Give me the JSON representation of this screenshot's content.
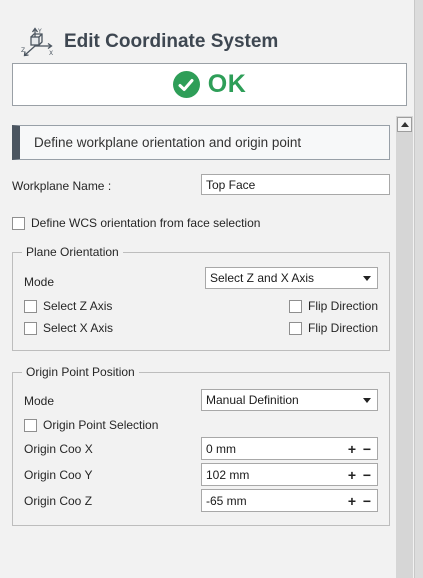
{
  "header": {
    "title": "Edit Coordinate System",
    "icon": "coordinate-system-icon",
    "axis_labels": [
      "Y",
      "Z",
      "X"
    ]
  },
  "ok_button": {
    "label": "OK",
    "icon": "check-circle-icon",
    "color": "#2e9e58"
  },
  "section_banner": {
    "text": "Define workplane orientation and origin point"
  },
  "workplane": {
    "label": "Workplane Name :",
    "value": "Top Face"
  },
  "wcs_checkbox": {
    "label": "Define WCS orientation from face selection",
    "checked": false
  },
  "plane_orientation": {
    "title": "Plane Orientation",
    "mode_label": "Mode",
    "mode_value": "Select Z and X Axis",
    "select_z": {
      "label": "Select Z Axis",
      "checked": false
    },
    "select_x": {
      "label": "Select X Axis",
      "checked": false
    },
    "flip_z": {
      "label": "Flip Direction",
      "checked": false
    },
    "flip_x": {
      "label": "Flip Direction",
      "checked": false
    }
  },
  "origin_point": {
    "title": "Origin Point Position",
    "mode_label": "Mode",
    "mode_value": "Manual Definition",
    "selection": {
      "label": "Origin Point Selection",
      "checked": false
    },
    "coo_x": {
      "label": "Origin Coo X",
      "value": "0 mm"
    },
    "coo_y": {
      "label": "Origin Coo Y",
      "value": "102 mm"
    },
    "coo_z": {
      "label": "Origin Coo Z",
      "value": "-65 mm"
    },
    "plus": "+",
    "minus": "−"
  }
}
